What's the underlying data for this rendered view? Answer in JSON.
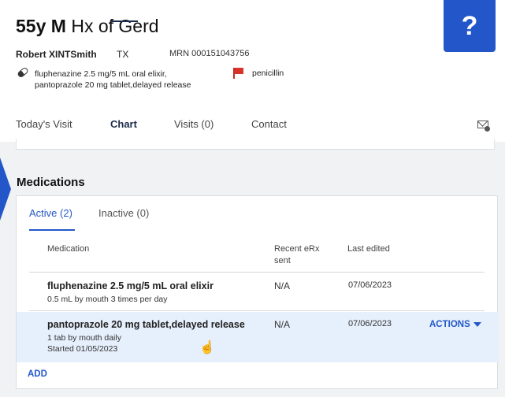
{
  "patient": {
    "age_sex": "55y M",
    "history": "Hx of Gerd",
    "name": "Robert XINTSmith",
    "state": "TX",
    "mrn": "MRN 000151043756",
    "med_summary": [
      "fluphenazine 2.5 mg/5 mL oral elixir,",
      "pantoprazole 20 mg tablet,delayed release"
    ],
    "allergy": "penicillin"
  },
  "help_label": "?",
  "tabs": [
    {
      "label": "Today's Visit",
      "active": false
    },
    {
      "label": "Chart",
      "active": true
    },
    {
      "label": "Visits (0)",
      "active": false
    },
    {
      "label": "Contact",
      "active": false
    }
  ],
  "medications": {
    "title": "Medications",
    "tabs": [
      {
        "label": "Active (2)",
        "active": true
      },
      {
        "label": "Inactive (0)",
        "active": false
      }
    ],
    "columns": {
      "medication": "Medication",
      "recent_erx": [
        "Recent eRx",
        "sent"
      ],
      "last_edited": "Last edited"
    },
    "rows": [
      {
        "name": "fluphenazine 2.5 mg/5 mL oral elixir",
        "sig": "0.5 mL by mouth 3 times per day",
        "erx": "N/A",
        "edited": "07/06/2023",
        "selected": false
      },
      {
        "name": "pantoprazole 20 mg tablet,delayed release",
        "sig": "1 tab by mouth daily",
        "started": "Started 01/05/2023",
        "erx": "N/A",
        "edited": "07/06/2023",
        "selected": true
      }
    ],
    "actions_label": "ACTIONS",
    "add_label": "ADD"
  },
  "colors": {
    "accent": "#2357c9",
    "selected_row": "#e6effc",
    "flag": "#d7332b"
  }
}
